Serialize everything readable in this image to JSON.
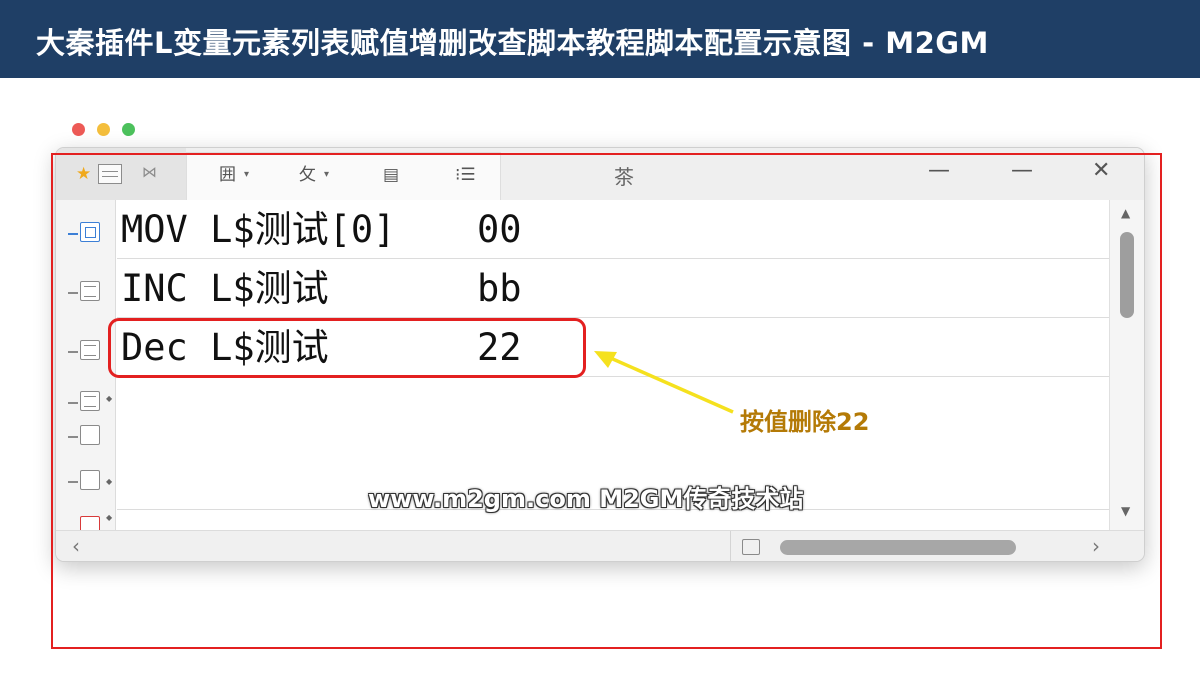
{
  "banner": {
    "title": "大秦插件L变量元素列表赋值增删改查脚本教程脚本配置示意图 - M2GM"
  },
  "window_dots": {
    "colors": [
      "#ed5a56",
      "#f4be3c",
      "#4cc15c"
    ]
  },
  "toolbar": {
    "star_icon": "★",
    "tie_icon": "⋈",
    "items": [
      {
        "glyph": "囲",
        "caret": "▾"
      },
      {
        "glyph": "攵",
        "caret": "▾"
      },
      {
        "glyph": "▤",
        "caret": ""
      },
      {
        "glyph": "⁝☰",
        "caret": ""
      }
    ],
    "center_glyph": "茶",
    "controls": {
      "minimize1": "—",
      "minimize2": "—",
      "close": "✕"
    }
  },
  "script_rows": [
    {
      "command": "MOV L$测试[0]",
      "value": "00"
    },
    {
      "command": "INC L$测试",
      "value": "bb"
    },
    {
      "command": "Dec L$测试",
      "value": "22"
    },
    {
      "command": "",
      "value": ""
    },
    {
      "command": "",
      "value": ""
    }
  ],
  "scrollbar": {
    "up": "▲",
    "down": "▼",
    "left": "‹",
    "right": "›"
  },
  "annotation": {
    "callout": "按值删除22",
    "highlight_color": "#e32020",
    "arrow_color": "#f5e11e"
  },
  "watermark": "www.m2gm.com M2GM传奇技术站"
}
